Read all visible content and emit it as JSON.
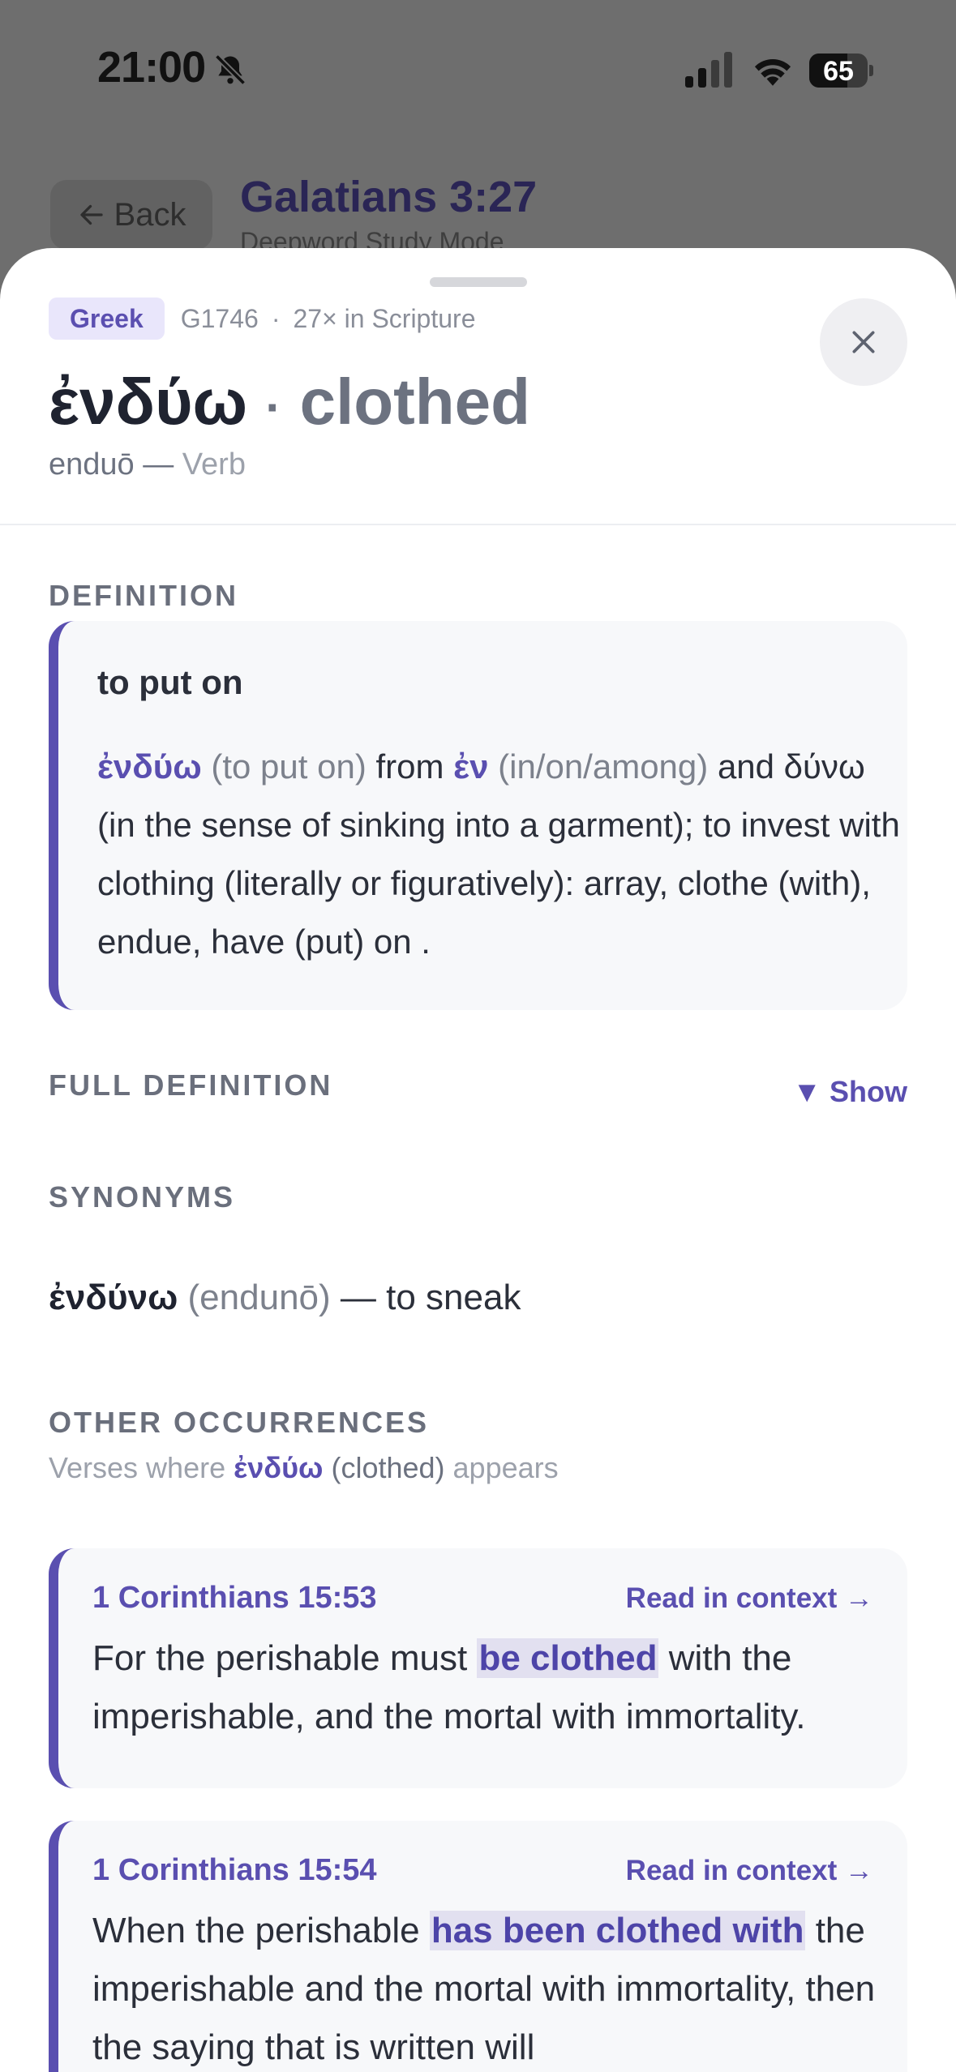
{
  "status": {
    "time": "21:00",
    "battery": "65",
    "battery_level": 0.65
  },
  "background": {
    "back_label": "Back",
    "title": "Galatians 3:27",
    "subtitle": "Deepword Study Mode"
  },
  "word": {
    "language": "Greek",
    "strongs": "G1746",
    "count": "27× in Scripture",
    "greek": "ἐνδύω",
    "separator": "·",
    "gloss": "clothed",
    "transliteration": "enduō —",
    "part_of_speech": "Verb"
  },
  "definition": {
    "label": "DEFINITION",
    "short": "to put on",
    "w1": "ἐνδύω",
    "w1_gloss": "(to put on)",
    "from": "from",
    "w2": "ἐν",
    "w2_gloss": "(in/on/among)",
    "rest": "and δύνω (in the sense of sinking into a garment); to invest with clothing (literally or figuratively): array, clothe (with), endue, have (put) on ."
  },
  "full_definition": {
    "label": "FULL DEFINITION",
    "toggle": "▼ Show"
  },
  "synonyms": {
    "label": "SYNONYMS",
    "items": [
      {
        "greek": "ἐνδύνω",
        "translit": "(endunō)",
        "meaning": "— to sneak"
      }
    ]
  },
  "occurrences": {
    "label": "OTHER OCCURRENCES",
    "sub_prefix": "Verses where",
    "sub_word": "ἐνδύω",
    "sub_gloss": "(clothed)",
    "sub_suffix": "appears",
    "link_label": "Read in context →",
    "items": [
      {
        "ref": "1 Corinthians 15:53",
        "before": "For the perishable must",
        "highlight": "be clothed",
        "after": "with the imperishable, and the mortal with immortality."
      },
      {
        "ref": "1 Corinthians 15:54",
        "before": "When the perishable",
        "highlight": "has been clothed with",
        "after": "the imperishable and the mortal with immortality, then the saying that is written will"
      }
    ]
  },
  "colors": {
    "accent": "#5a4fb0",
    "badge_bg": "#e9e6fb",
    "card_bg": "#f7f8fa",
    "highlight_bg": "#e2e0f0",
    "scrim": "#6e6e6e"
  }
}
